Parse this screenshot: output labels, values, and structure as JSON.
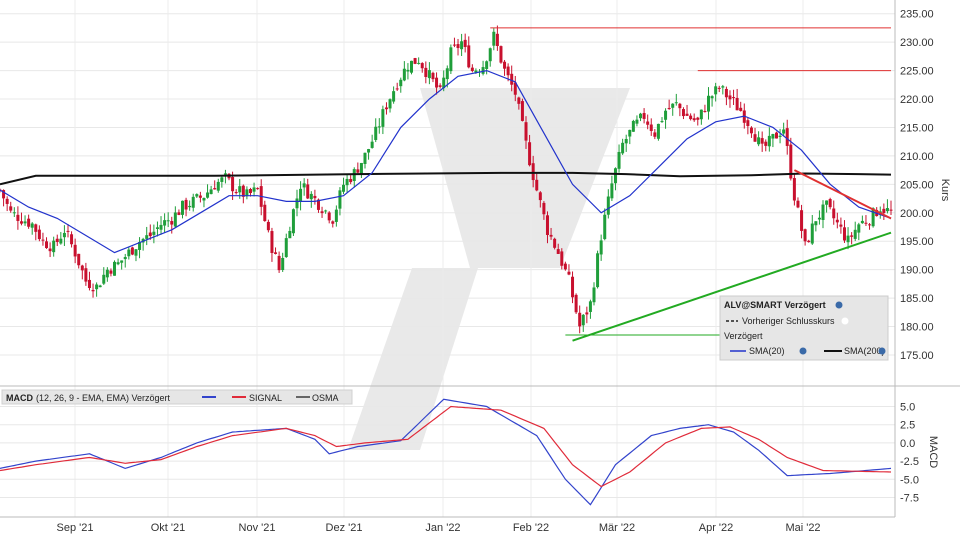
{
  "chart_data": [
    {
      "type": "candlestick",
      "ylabel": "Kurs",
      "ylim": [
        172,
        236
      ],
      "y_ticks": [
        "235.00",
        "230.00",
        "225.00",
        "220.00",
        "215.00",
        "210.00",
        "205.00",
        "200.00",
        "195.00",
        "190.00",
        "185.00",
        "180.00",
        "175.00"
      ],
      "y_tick_values": [
        235,
        230,
        225,
        220,
        215,
        210,
        205,
        200,
        195,
        190,
        185,
        180,
        175
      ],
      "x_tick_labels": [
        "Sep '21",
        "Okt '21",
        "Nov '21",
        "Dez '21",
        "Jan '22",
        "Feb '22",
        "Mär '22",
        "Apr '22",
        "Mai '22"
      ],
      "grid": true,
      "legend": {
        "title": "ALV@SMART Verzögert",
        "line1": "Vorheriger Schlusskurs",
        "line2": "Verzögert",
        "sma20": "SMA(20)",
        "sma200": "SMA(200)",
        "placement": "bottom-right"
      },
      "colors": {
        "up": "#1f9e3a",
        "down": "#c8102e",
        "sma20": "#2233cc",
        "sma200": "#111111",
        "resistance": "#e03030",
        "support": "#22aa22"
      },
      "close_series": [
        [
          0,
          204
        ],
        [
          3,
          200
        ],
        [
          6,
          199
        ],
        [
          9,
          198
        ],
        [
          12,
          195
        ],
        [
          15,
          194
        ],
        [
          18,
          197
        ],
        [
          21,
          193
        ],
        [
          24,
          188
        ],
        [
          27,
          187
        ],
        [
          30,
          190
        ],
        [
          33,
          191
        ],
        [
          36,
          193
        ],
        [
          39,
          195
        ],
        [
          42,
          196
        ],
        [
          45,
          198
        ],
        [
          48,
          199
        ],
        [
          51,
          201
        ],
        [
          54,
          202
        ],
        [
          57,
          203
        ],
        [
          60,
          205
        ],
        [
          63,
          206
        ],
        [
          66,
          204
        ],
        [
          69,
          203
        ],
        [
          72,
          204
        ],
        [
          75,
          196
        ],
        [
          78,
          190
        ],
        [
          81,
          198
        ],
        [
          84,
          205
        ],
        [
          87,
          203
        ],
        [
          90,
          201
        ],
        [
          93,
          199
        ],
        [
          96,
          205
        ],
        [
          99,
          207
        ],
        [
          102,
          210
        ],
        [
          105,
          214
        ],
        [
          108,
          219
        ],
        [
          111,
          223
        ],
        [
          114,
          226
        ],
        [
          117,
          227
        ],
        [
          120,
          224
        ],
        [
          123,
          221
        ],
        [
          126,
          228
        ],
        [
          129,
          230
        ],
        [
          132,
          225
        ],
        [
          135,
          226
        ],
        [
          138,
          231
        ],
        [
          141,
          225
        ],
        [
          144,
          221
        ],
        [
          147,
          212
        ],
        [
          150,
          204
        ],
        [
          153,
          197
        ],
        [
          156,
          193
        ],
        [
          159,
          188
        ],
        [
          162,
          180
        ],
        [
          165,
          184
        ],
        [
          168,
          196
        ],
        [
          171,
          205
        ],
        [
          174,
          212
        ],
        [
          177,
          215
        ],
        [
          180,
          217
        ],
        [
          183,
          214
        ],
        [
          186,
          218
        ],
        [
          189,
          219
        ],
        [
          192,
          217
        ],
        [
          195,
          216
        ],
        [
          198,
          220
        ],
        [
          201,
          222
        ],
        [
          204,
          220
        ],
        [
          207,
          218
        ],
        [
          210,
          215
        ],
        [
          213,
          211
        ],
        [
          216,
          213
        ],
        [
          219,
          215
        ],
        [
          222,
          203
        ],
        [
          225,
          194
        ],
        [
          228,
          199
        ],
        [
          231,
          201
        ],
        [
          234,
          198
        ],
        [
          237,
          195
        ],
        [
          240,
          198
        ],
        [
          243,
          199
        ],
        [
          246,
          201
        ],
        [
          249,
          200
        ]
      ],
      "sma20_series": [
        [
          0,
          204
        ],
        [
          8,
          201
        ],
        [
          16,
          199
        ],
        [
          24,
          196
        ],
        [
          32,
          193
        ],
        [
          40,
          195
        ],
        [
          48,
          197
        ],
        [
          56,
          200
        ],
        [
          64,
          203
        ],
        [
          72,
          203
        ],
        [
          80,
          202
        ],
        [
          88,
          202
        ],
        [
          96,
          203
        ],
        [
          104,
          207
        ],
        [
          112,
          215
        ],
        [
          120,
          220
        ],
        [
          128,
          224
        ],
        [
          136,
          225
        ],
        [
          144,
          223
        ],
        [
          152,
          214
        ],
        [
          160,
          205
        ],
        [
          168,
          200
        ],
        [
          176,
          203
        ],
        [
          184,
          208
        ],
        [
          192,
          213
        ],
        [
          200,
          216
        ],
        [
          208,
          217
        ],
        [
          216,
          215
        ],
        [
          224,
          211
        ],
        [
          232,
          205
        ],
        [
          240,
          201
        ],
        [
          249,
          199
        ]
      ],
      "sma200_series": [
        [
          0,
          205
        ],
        [
          10,
          206.5
        ],
        [
          30,
          206.5
        ],
        [
          60,
          206.5
        ],
        [
          100,
          206.8
        ],
        [
          140,
          207
        ],
        [
          160,
          207
        ],
        [
          175,
          206.8
        ],
        [
          190,
          206.4
        ],
        [
          210,
          206.6
        ],
        [
          225,
          206.9
        ],
        [
          240,
          206.8
        ],
        [
          249,
          206.7
        ]
      ],
      "resistance_lines": [
        {
          "value": 232.5,
          "x_from": 137,
          "x_to": 249
        },
        {
          "value": 225,
          "x_from": 195,
          "x_to": 249
        }
      ],
      "support_line_horizontal": {
        "value": 178.5,
        "x_from": 158,
        "x_to": 225
      },
      "trend_support": {
        "x0": 160,
        "y0": 177.5,
        "x1": 249,
        "y1": 196.5
      },
      "trend_resistance": {
        "x0": 222,
        "y0": 207.5,
        "x1": 249,
        "y1": 199
      }
    },
    {
      "type": "line",
      "ylabel": "MACD",
      "ylim": [
        -9.5,
        7
      ],
      "y_ticks": [
        "5.0",
        "2.5",
        "0.0",
        "-2.5",
        "-5.0",
        "-7.5"
      ],
      "y_tick_values": [
        5,
        2.5,
        0,
        -2.5,
        -5,
        -7.5
      ],
      "legend": {
        "title": "MACD",
        "params": "(12, 26, 9 - EMA, EMA) Verzögert",
        "signal": "SIGNAL",
        "osma": "OSMA",
        "placement": "top-left"
      },
      "series": [
        {
          "name": "MACD",
          "color": "#3344cc",
          "points": [
            [
              0,
              -3.5
            ],
            [
              10,
              -2.5
            ],
            [
              25,
              -1.5
            ],
            [
              35,
              -3.5
            ],
            [
              45,
              -2
            ],
            [
              55,
              0
            ],
            [
              65,
              1.5
            ],
            [
              80,
              2
            ],
            [
              88,
              0.5
            ],
            [
              92,
              -1.5
            ],
            [
              100,
              -0.5
            ],
            [
              112,
              0.3
            ],
            [
              124,
              6
            ],
            [
              136,
              5
            ],
            [
              150,
              1
            ],
            [
              158,
              -5
            ],
            [
              165,
              -8.5
            ],
            [
              172,
              -3
            ],
            [
              182,
              1
            ],
            [
              190,
              2
            ],
            [
              198,
              2.5
            ],
            [
              205,
              1.5
            ],
            [
              212,
              -1
            ],
            [
              220,
              -4.5
            ],
            [
              232,
              -4.2
            ],
            [
              249,
              -3.5
            ]
          ]
        },
        {
          "name": "SIGNAL",
          "color": "#e02b3a",
          "points": [
            [
              0,
              -3.8
            ],
            [
              10,
              -3
            ],
            [
              25,
              -2
            ],
            [
              35,
              -2.8
            ],
            [
              45,
              -2.3
            ],
            [
              55,
              -0.5
            ],
            [
              65,
              1
            ],
            [
              80,
              2
            ],
            [
              88,
              1
            ],
            [
              94,
              -0.5
            ],
            [
              102,
              0
            ],
            [
              114,
              0.5
            ],
            [
              126,
              5
            ],
            [
              140,
              4.5
            ],
            [
              152,
              2
            ],
            [
              160,
              -3
            ],
            [
              168,
              -6
            ],
            [
              176,
              -4
            ],
            [
              186,
              0
            ],
            [
              196,
              2
            ],
            [
              204,
              2.2
            ],
            [
              212,
              0.5
            ],
            [
              220,
              -2
            ],
            [
              230,
              -3.8
            ],
            [
              249,
              -4
            ]
          ]
        }
      ]
    }
  ]
}
